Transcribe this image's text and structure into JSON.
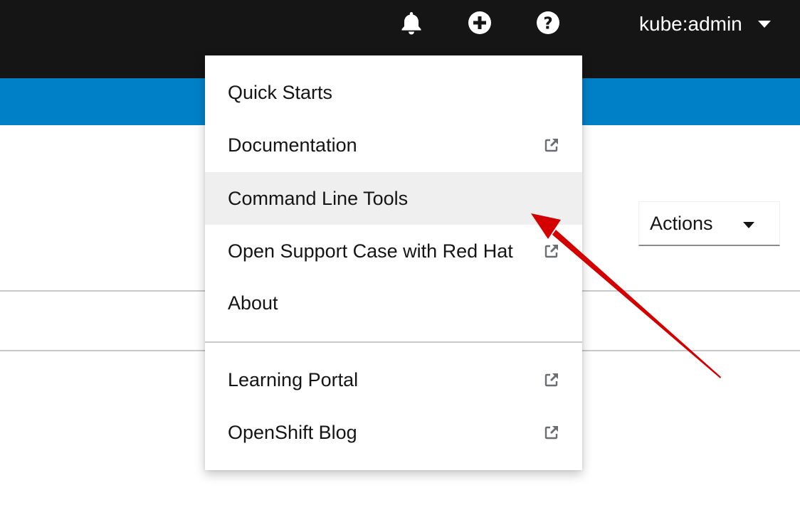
{
  "masthead": {
    "icons": [
      {
        "name": "bell-icon"
      },
      {
        "name": "plus-circle-icon"
      },
      {
        "name": "question-circle-icon"
      }
    ],
    "user": "kube:admin",
    "colors": {
      "background": "#151515",
      "subheader": "#0080c7"
    }
  },
  "actions": {
    "label": "Actions"
  },
  "help_menu": {
    "items": [
      {
        "label": "Quick Starts",
        "external": false
      },
      {
        "label": "Documentation",
        "external": true
      },
      {
        "label": "Command Line Tools",
        "external": false,
        "highlighted": true
      },
      {
        "label": "Open Support Case with Red Hat",
        "external": true
      },
      {
        "label": "About",
        "external": false
      }
    ],
    "secondary_items": [
      {
        "label": "Learning Portal",
        "external": true
      },
      {
        "label": "OpenShift Blog",
        "external": true
      }
    ]
  },
  "annotation": {
    "type": "arrow",
    "color": "#d40000",
    "points_to": "Command Line Tools"
  }
}
